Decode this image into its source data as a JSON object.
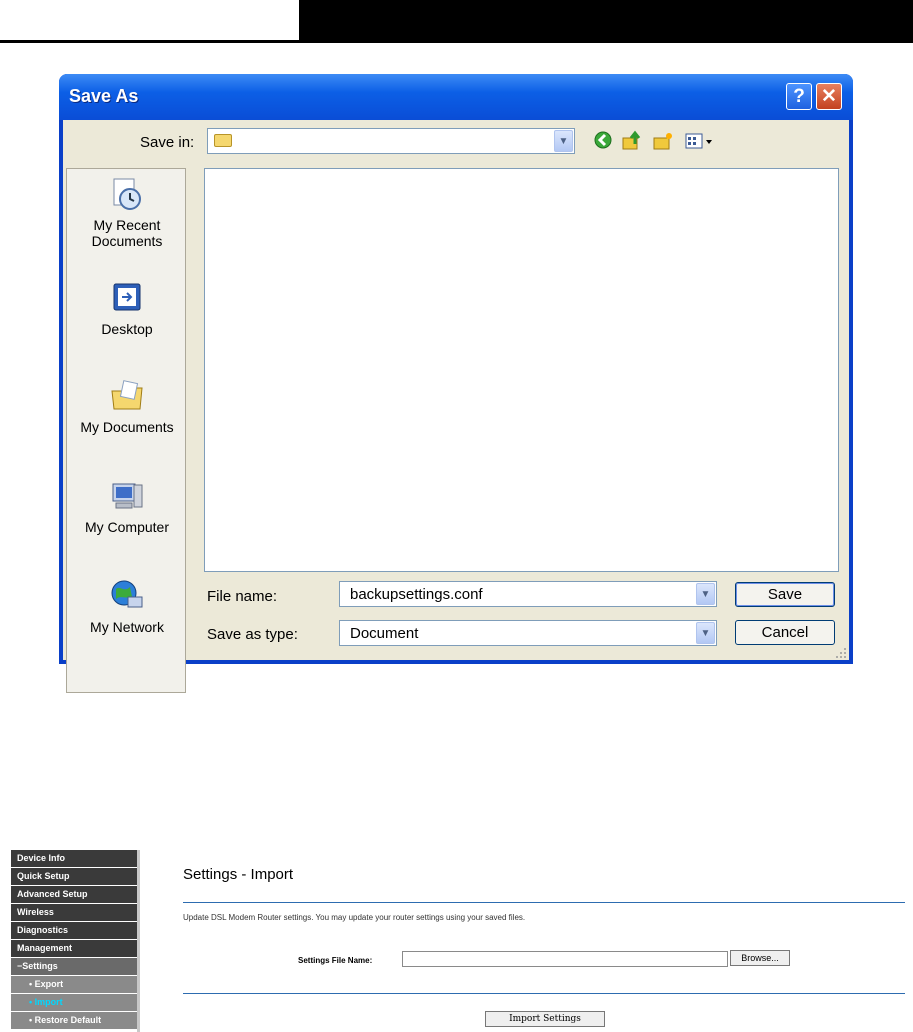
{
  "dialog": {
    "title": "Save As",
    "help_icon": "?",
    "close_icon": "✕",
    "save_in_label": "Save in:",
    "save_in_value": "",
    "toolbar_icons": [
      "back-icon",
      "up-folder-icon",
      "new-folder-icon",
      "view-menu-icon"
    ],
    "places": [
      {
        "label": "My Recent Documents",
        "icon": "recent-documents-icon"
      },
      {
        "label": "Desktop",
        "icon": "desktop-icon"
      },
      {
        "label": "My Documents",
        "icon": "my-documents-icon"
      },
      {
        "label": "My Computer",
        "icon": "my-computer-icon"
      },
      {
        "label": "My Network",
        "icon": "my-network-icon"
      }
    ],
    "file_name_label": "File name:",
    "file_name_value": "backupsettings.conf",
    "save_as_type_label": "Save as type:",
    "save_as_type_value": "Document",
    "save_button": "Save",
    "cancel_button": "Cancel"
  },
  "router": {
    "sidebar": [
      {
        "label": "Device Info",
        "level": 0,
        "active": false
      },
      {
        "label": "Quick Setup",
        "level": 0,
        "active": false
      },
      {
        "label": "Advanced Setup",
        "level": 0,
        "active": false
      },
      {
        "label": "Wireless",
        "level": 0,
        "active": false
      },
      {
        "label": "Diagnostics",
        "level": 0,
        "active": false
      },
      {
        "label": "Management",
        "level": 0,
        "active": false
      },
      {
        "label": "−Settings",
        "level": 1,
        "active": false
      },
      {
        "label": "• Export",
        "level": 2,
        "active": false
      },
      {
        "label": "• Import",
        "level": 2,
        "active": true
      },
      {
        "label": "• Restore Default",
        "level": 2,
        "active": false
      }
    ],
    "page_title": "Settings - Import",
    "description": "Update DSL Modem Router settings. You may update your router settings using your saved files.",
    "file_field_label": "Settings File Name:",
    "file_field_value": "",
    "browse_button": "Browse...",
    "import_button": "Import Settings"
  },
  "colors": {
    "titlebar": "#0c5fe6",
    "dialog_face": "#ece9d8",
    "sidebar_active": "#00d8ff"
  }
}
